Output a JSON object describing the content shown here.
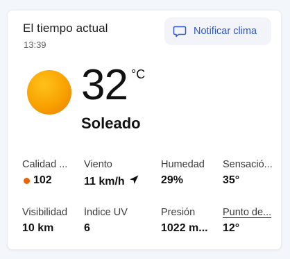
{
  "header": {
    "title": "El tiempo actual",
    "time": "13:39",
    "notify_label": "Notificar clima"
  },
  "current": {
    "temperature": "32",
    "unit": "°C",
    "condition": "Soleado",
    "icon": "sun-icon"
  },
  "metrics": {
    "air_quality": {
      "label": "Calidad ...",
      "value": "102",
      "color": "#e8630a"
    },
    "wind": {
      "label": "Viento",
      "value": "11 km/h",
      "icon": "wind-direction-arrow-icon"
    },
    "humidity": {
      "label": "Humedad",
      "value": "29%"
    },
    "feels_like": {
      "label": "Sensació...",
      "value": "35°"
    },
    "visibility": {
      "label": "Visibilidad",
      "value": "10 km"
    },
    "uv_index": {
      "label": "Índice UV",
      "value": "6"
    },
    "pressure": {
      "label": "Presión",
      "value": "1022 m..."
    },
    "dew_point": {
      "label": "Punto de...",
      "value": "12°"
    }
  },
  "colors": {
    "accent": "#2c58c9",
    "sun": "#f8a100"
  }
}
